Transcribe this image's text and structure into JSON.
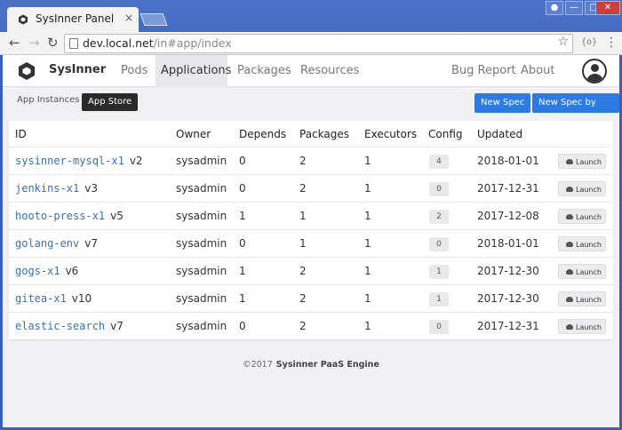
{
  "browser": {
    "tab_title": "SysInner Panel",
    "tab_close": "×",
    "url_host": "dev.local.net",
    "url_path": "/in#app/index",
    "ext_label": "{o}",
    "win_minimize": "—",
    "win_maximize": "□",
    "win_close": "✕"
  },
  "app": {
    "brand": "SysInner",
    "nav": [
      "Pods",
      "Applications",
      "Packages",
      "Resources"
    ],
    "nav_right": [
      "Bug Report",
      "About"
    ],
    "subtabs": [
      "App Instances",
      "App Store"
    ],
    "actions": [
      "New Spec",
      "New Spec by Raw"
    ]
  },
  "table": {
    "headers": [
      "ID",
      "Owner",
      "Depends",
      "Packages",
      "Executors",
      "Config",
      "Updated"
    ],
    "launch_label": "Launch",
    "rows": [
      {
        "id": "sysinner-mysql-x1",
        "version": "v2",
        "owner": "sysadmin",
        "depends": "0",
        "packages": "2",
        "executors": "1",
        "config": "4",
        "updated": "2018-01-01"
      },
      {
        "id": "jenkins-x1",
        "version": "v3",
        "owner": "sysadmin",
        "depends": "0",
        "packages": "2",
        "executors": "1",
        "config": "0",
        "updated": "2017-12-31"
      },
      {
        "id": "hooto-press-x1",
        "version": "v5",
        "owner": "sysadmin",
        "depends": "1",
        "packages": "1",
        "executors": "1",
        "config": "2",
        "updated": "2017-12-08"
      },
      {
        "id": "golang-env",
        "version": "v7",
        "owner": "sysadmin",
        "depends": "0",
        "packages": "1",
        "executors": "1",
        "config": "0",
        "updated": "2018-01-01"
      },
      {
        "id": "gogs-x1",
        "version": "v6",
        "owner": "sysadmin",
        "depends": "1",
        "packages": "2",
        "executors": "1",
        "config": "1",
        "updated": "2017-12-30"
      },
      {
        "id": "gitea-x1",
        "version": "v10",
        "owner": "sysadmin",
        "depends": "1",
        "packages": "2",
        "executors": "1",
        "config": "1",
        "updated": "2017-12-30"
      },
      {
        "id": "elastic-search",
        "version": "v7",
        "owner": "sysadmin",
        "depends": "0",
        "packages": "2",
        "executors": "1",
        "config": "0",
        "updated": "2017-12-31"
      }
    ]
  },
  "footer": {
    "copyright": "©2017",
    "brand": "Sysinner PaaS Engine"
  },
  "colors": {
    "primary": "#2d7be0",
    "link": "#3d70ae",
    "chrome": "#3d63bd"
  }
}
